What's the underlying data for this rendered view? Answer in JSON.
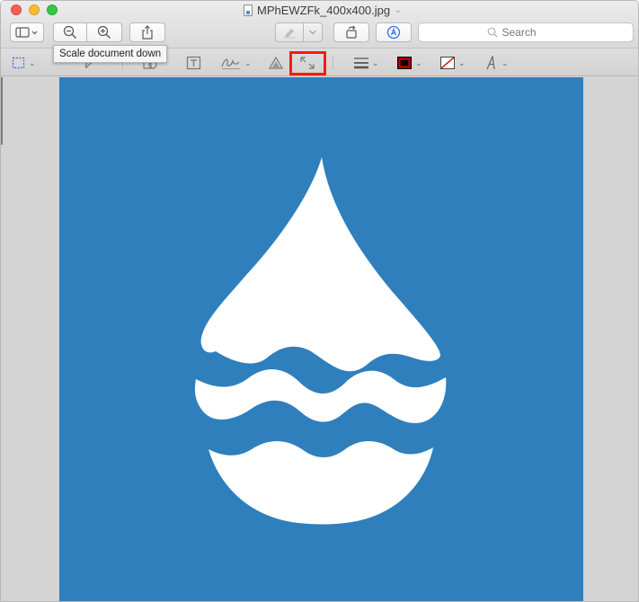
{
  "window": {
    "title": "MPhEWZFk_400x400.jpg"
  },
  "toolbar": {
    "search_placeholder": "Search",
    "tooltip": "Scale document down"
  },
  "markup_toolbar": {
    "icons": [
      "rect-selection-icon",
      "sketch-icon",
      "shapes-icon",
      "text-box-icon",
      "signature-icon",
      "adjust-color-icon",
      "adjust-size-icon",
      "shape-style-icon",
      "border-color-icon",
      "fill-color-icon",
      "text-style-icon"
    ],
    "highlighted_tool": "adjust-size-icon"
  },
  "document": {
    "image_name": "MPhEWZFk_400x400.jpg",
    "background_color": "#2f7fbd",
    "logo_color": "#ffffff"
  },
  "colors": {
    "highlight": "#ff1a00",
    "border_tool": "#c00000"
  }
}
